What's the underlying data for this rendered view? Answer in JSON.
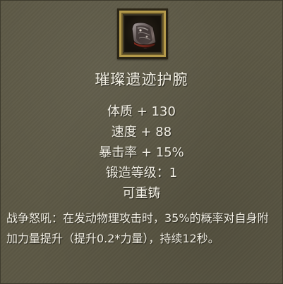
{
  "item": {
    "name": "璀璨遗迹护腕",
    "icon": "bracer-icon"
  },
  "stats": [
    "体质 + 130",
    "速度 + 88",
    "暴击率 + 15%",
    "锻造等级：1",
    "可重铸"
  ],
  "effect": {
    "text": "战争怒吼：在发动物理攻击时，35%的概率对自身附加力量提升（提升0.2*力量），持续12秒。"
  },
  "colors": {
    "background": "#5c5845",
    "frame_gold": "#b49a4a",
    "text": "#f2efe4"
  }
}
